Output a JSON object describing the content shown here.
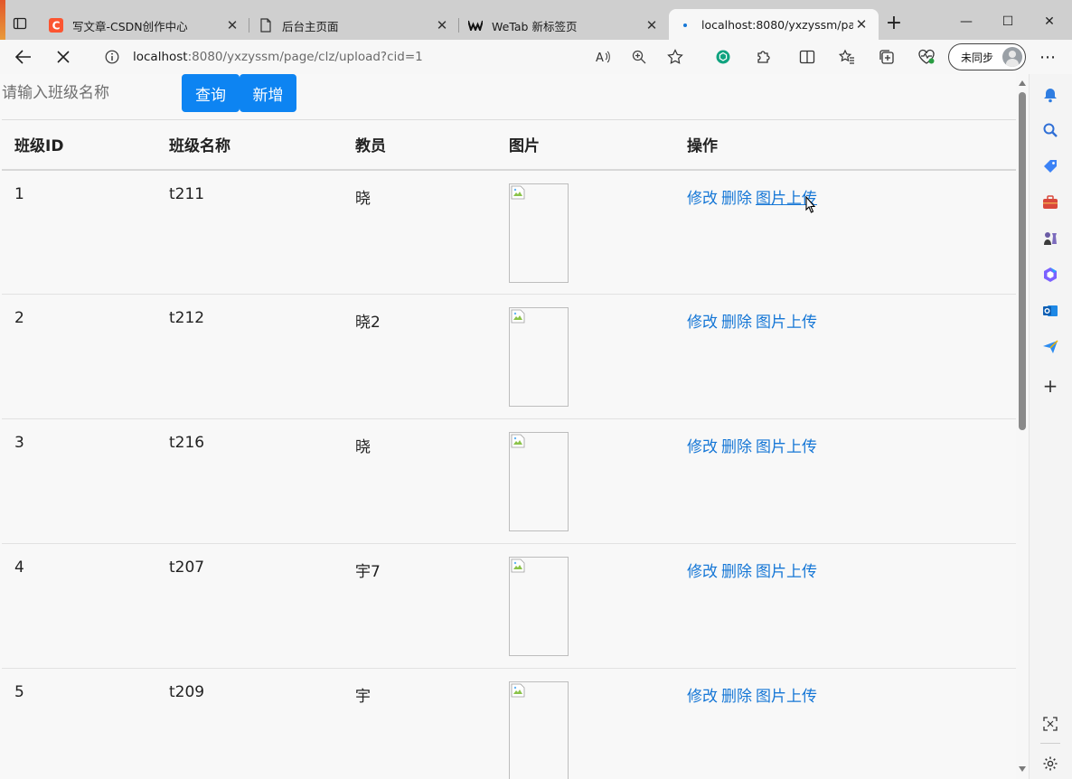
{
  "browser": {
    "tabs": [
      {
        "title": "写文章-CSDN创作中心",
        "favicon": "csdn-icon",
        "active": false
      },
      {
        "title": "后台主页面",
        "favicon": "page-icon",
        "active": false
      },
      {
        "title": "WeTab 新标签页",
        "favicon": "wetab-icon",
        "active": false
      },
      {
        "title": "localhost:8080/yxzyssm/page/c",
        "favicon": "loading-dot-icon",
        "active": true
      }
    ],
    "url_host": "localhost",
    "url_rest": ":8080/yxzyssm/page/clz/upload?cid=1",
    "sync_label": "未同步"
  },
  "search": {
    "placeholder": "请输入班级名称",
    "query_label": "查询",
    "add_label": "新增"
  },
  "table": {
    "headers": [
      "班级ID",
      "班级名称",
      "教员",
      "图片",
      "操作"
    ],
    "rows": [
      {
        "id": "1",
        "name": "t211",
        "teacher": "晓"
      },
      {
        "id": "2",
        "name": "t212",
        "teacher": "晓2"
      },
      {
        "id": "3",
        "name": "t216",
        "teacher": "晓"
      },
      {
        "id": "4",
        "name": "t207",
        "teacher": "宇7"
      },
      {
        "id": "5",
        "name": "t209",
        "teacher": "宇"
      }
    ],
    "actions": {
      "edit": "修改",
      "delete": "删除",
      "upload": "图片上传"
    }
  },
  "colors": {
    "primary": "#0d84f2",
    "link": "#1677d6"
  }
}
